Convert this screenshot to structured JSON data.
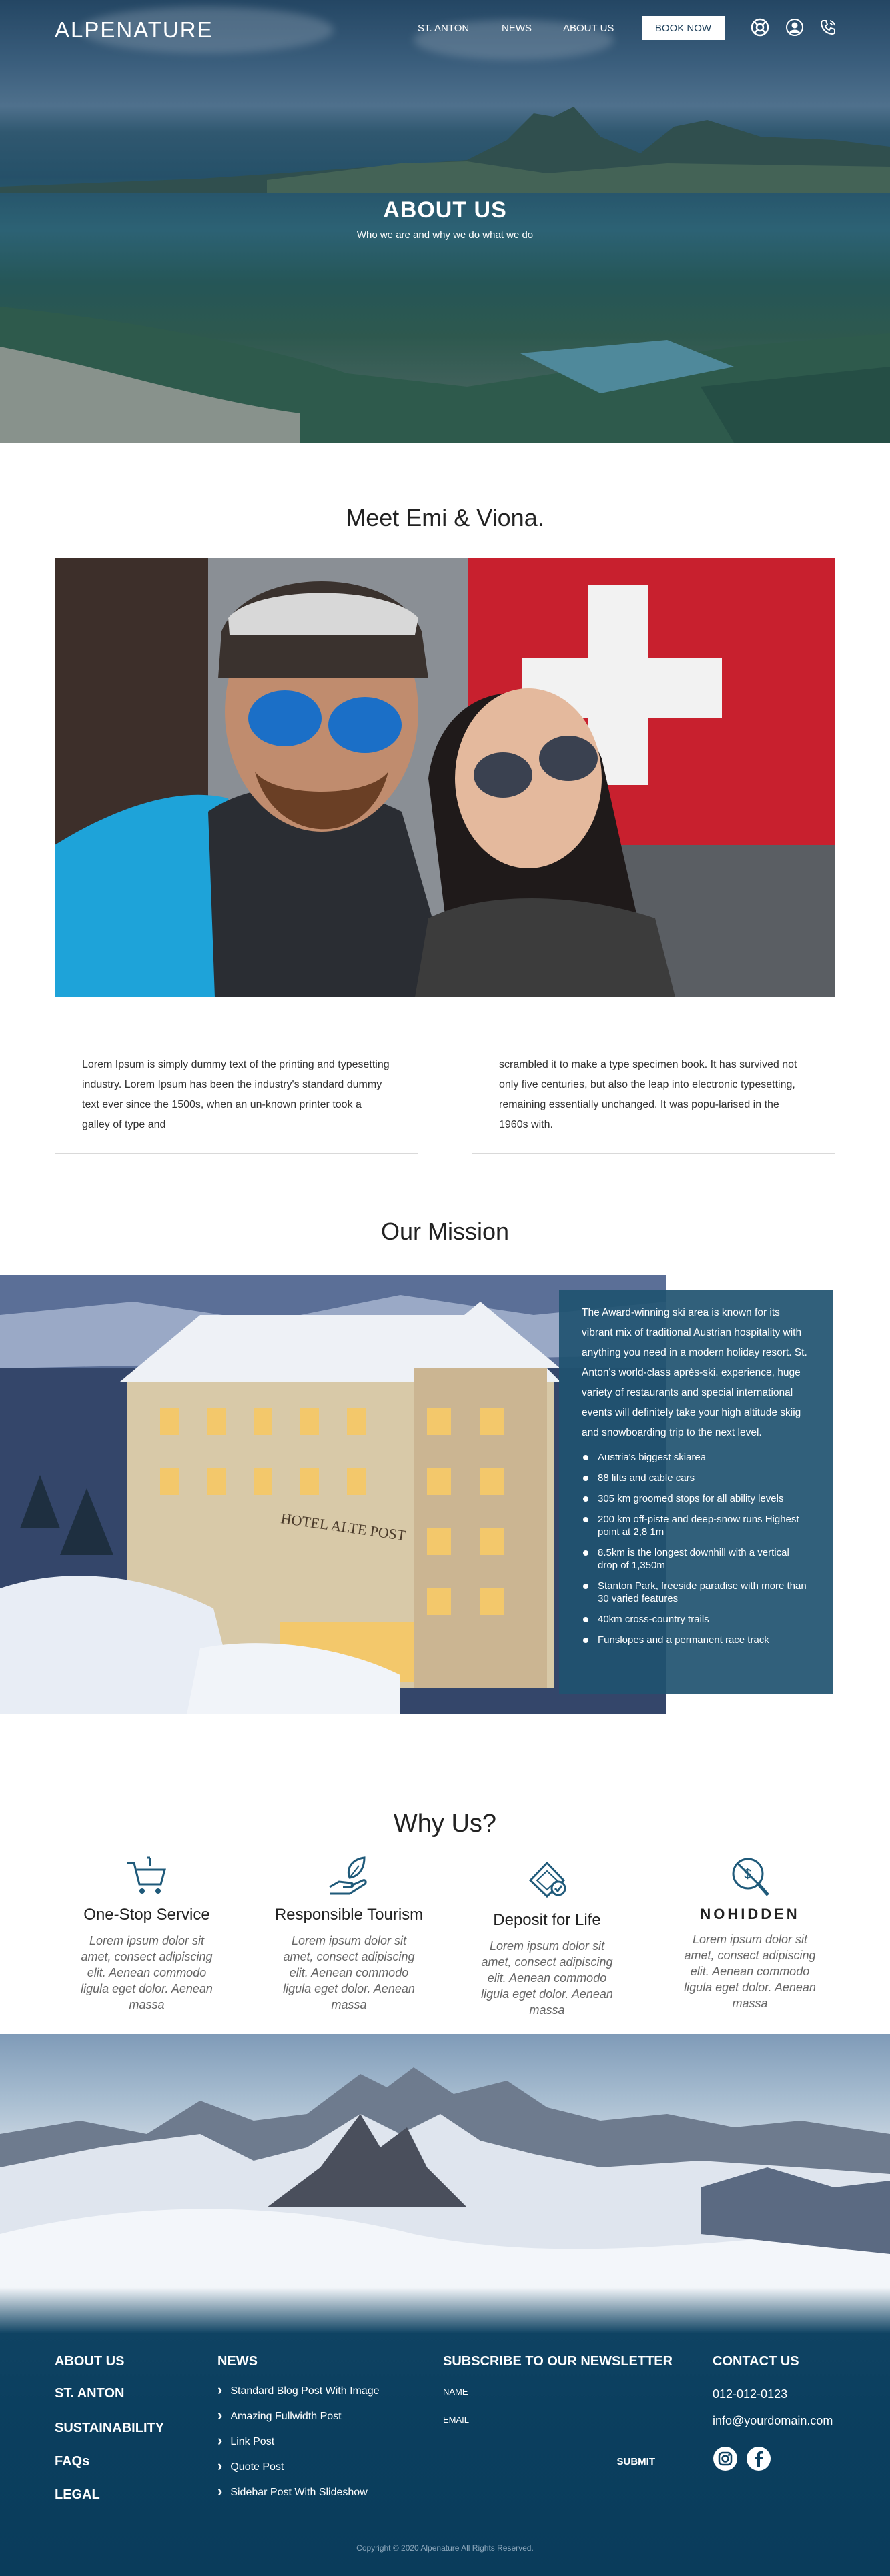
{
  "nav": {
    "logo": "ALPENATURE",
    "links": [
      "ST. ANTON",
      "NEWS",
      "ABOUT US"
    ],
    "book_label": "BOOK NOW",
    "icons": [
      "lifebuoy-icon",
      "user-icon",
      "phone-icon"
    ]
  },
  "hero": {
    "title": "ABOUT US",
    "subtitle": "Who we are and why we do what we do"
  },
  "meet": {
    "title": "Meet Emi & Viona.",
    "text_left": "Lorem Ipsum is simply dummy text of the printing and typesetting industry. Lorem Ipsum has been the industry's standard dummy text ever since the 1500s, when an un-known printer took a galley of type and",
    "text_right": "scrambled it to make a type specimen book. It has survived not only five centuries, but also the leap into electronic typesetting, remaining essentially unchanged. It was popu-larised in the 1960s with."
  },
  "mission": {
    "title": "Our Mission",
    "image_sign": "HOTEL ALTE POST",
    "intro": "The Award-winning ski area is known for its vibrant mix of traditional Austrian hospitality with anything you need in a modern holiday resort. St. Anton's world-class après-ski. experience, huge variety of restaurants and special international events will definitely take your high altitude skiig and snowboarding trip to the next level.",
    "bullets": [
      "Austria's biggest skiarea",
      "88 lifts and cable cars",
      "305 km groomed stops for all ability levels",
      "200 km off-piste and deep-snow runs Highest point at 2,8 1m",
      "8.5km is the longest downhill with a vertical drop of 1,350m",
      "Stanton Park, freeside paradise with more than 30 varied features",
      "40km cross-country trails",
      "Funslopes and a permanent race track"
    ]
  },
  "why": {
    "title": "Why Us?",
    "items": [
      {
        "title": "One-Stop Service",
        "text": "Lorem ipsum dolor sit amet, consect adipiscing elit. Aenean commodo ligula eget dolor. Aenean massa",
        "icon": "cart-icon"
      },
      {
        "title": "Responsible Tourism",
        "text": "Lorem ipsum dolor sit amet, consect adipiscing elit. Aenean commodo ligula eget dolor. Aenean massa",
        "icon": "hand-leaf-icon"
      },
      {
        "title": "Deposit for Life",
        "text": "Lorem ipsum dolor sit amet, consect adipiscing elit. Aenean commodo ligula eget dolor. Aenean massa",
        "icon": "deposit-icon"
      },
      {
        "title": "NOHIDDEN",
        "text": "Lorem ipsum dolor sit amet, consect adipiscing elit. Aenean commodo ligula eget dolor. Aenean massa",
        "icon": "no-hidden-fees-icon"
      }
    ]
  },
  "footer": {
    "main_links": [
      "ABOUT US",
      "ST. ANTON",
      "SUSTAINABILITY",
      "FAQs",
      "LEGAL"
    ],
    "news_head": "NEWS",
    "news_items": [
      "Standard Blog Post With Image",
      "Amazing Fullwidth Post",
      "Link Post",
      "Quote Post",
      "Sidebar Post With Slideshow"
    ],
    "newsletter_head": "SUBSCRIBE TO OUR NEWSLETTER",
    "name_placeholder": "NAME",
    "email_placeholder": "EMAIL",
    "submit_label": "SUBMIT",
    "contact_head": "CONTACT US",
    "phone": "012-012-0123",
    "email": "info@yourdomain.com",
    "social": [
      "instagram-icon",
      "facebook-icon"
    ],
    "copyright": "Copyright © 2020 Alpenature All Rights Reserved."
  },
  "colors": {
    "primary": "#0b3f5f",
    "mission_box": "#1f5270",
    "icon_blue": "#1f5a7a"
  }
}
